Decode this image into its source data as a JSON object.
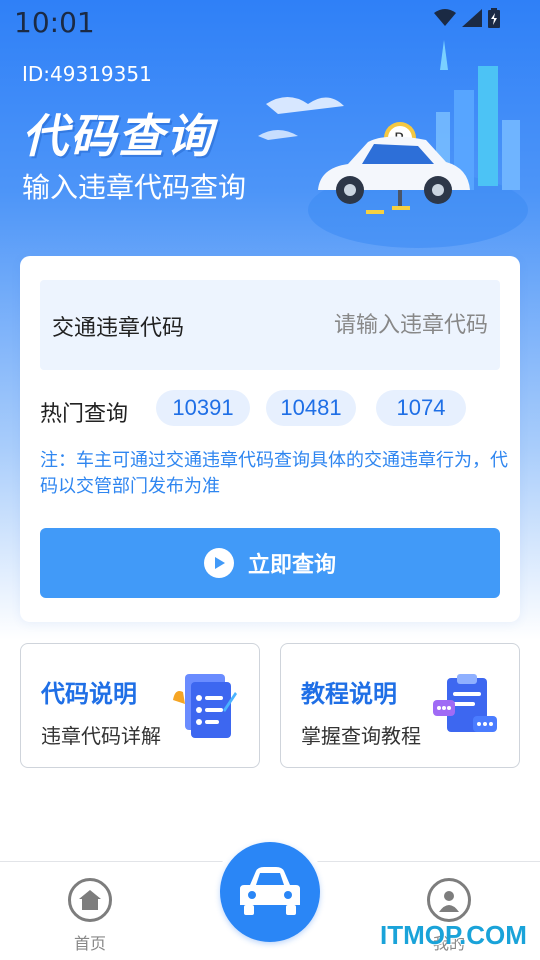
{
  "status_bar": {
    "time": "10:01"
  },
  "header": {
    "user_id": "ID:49319351",
    "title": "代码查询",
    "subtitle": "输入违章代码查询",
    "sign_letter": "P"
  },
  "query_card": {
    "input_label": "交通违章代码",
    "input_placeholder": "请输入违章代码",
    "input_value": "",
    "hot_label": "热门查询",
    "hot_codes": [
      "10391",
      "10481",
      "1074"
    ],
    "note": "注：车主可通过交通违章代码查询具体的交通违章行为，代码以交管部门发布为准",
    "query_button_label": "立即查询"
  },
  "features": [
    {
      "title": "代码说明",
      "desc": "违章代码详解",
      "icon": "document-list-icon"
    },
    {
      "title": "教程说明",
      "desc": "掌握查询教程",
      "icon": "clipboard-chat-icon"
    }
  ],
  "tab_bar": {
    "home_label": "首页",
    "profile_label": "我的"
  },
  "watermark": "ITMOP.COM",
  "colors": {
    "accent": "#2a86f6",
    "button": "#419af8",
    "chip_bg": "#e7f0fe",
    "note": "#2f86f0"
  }
}
